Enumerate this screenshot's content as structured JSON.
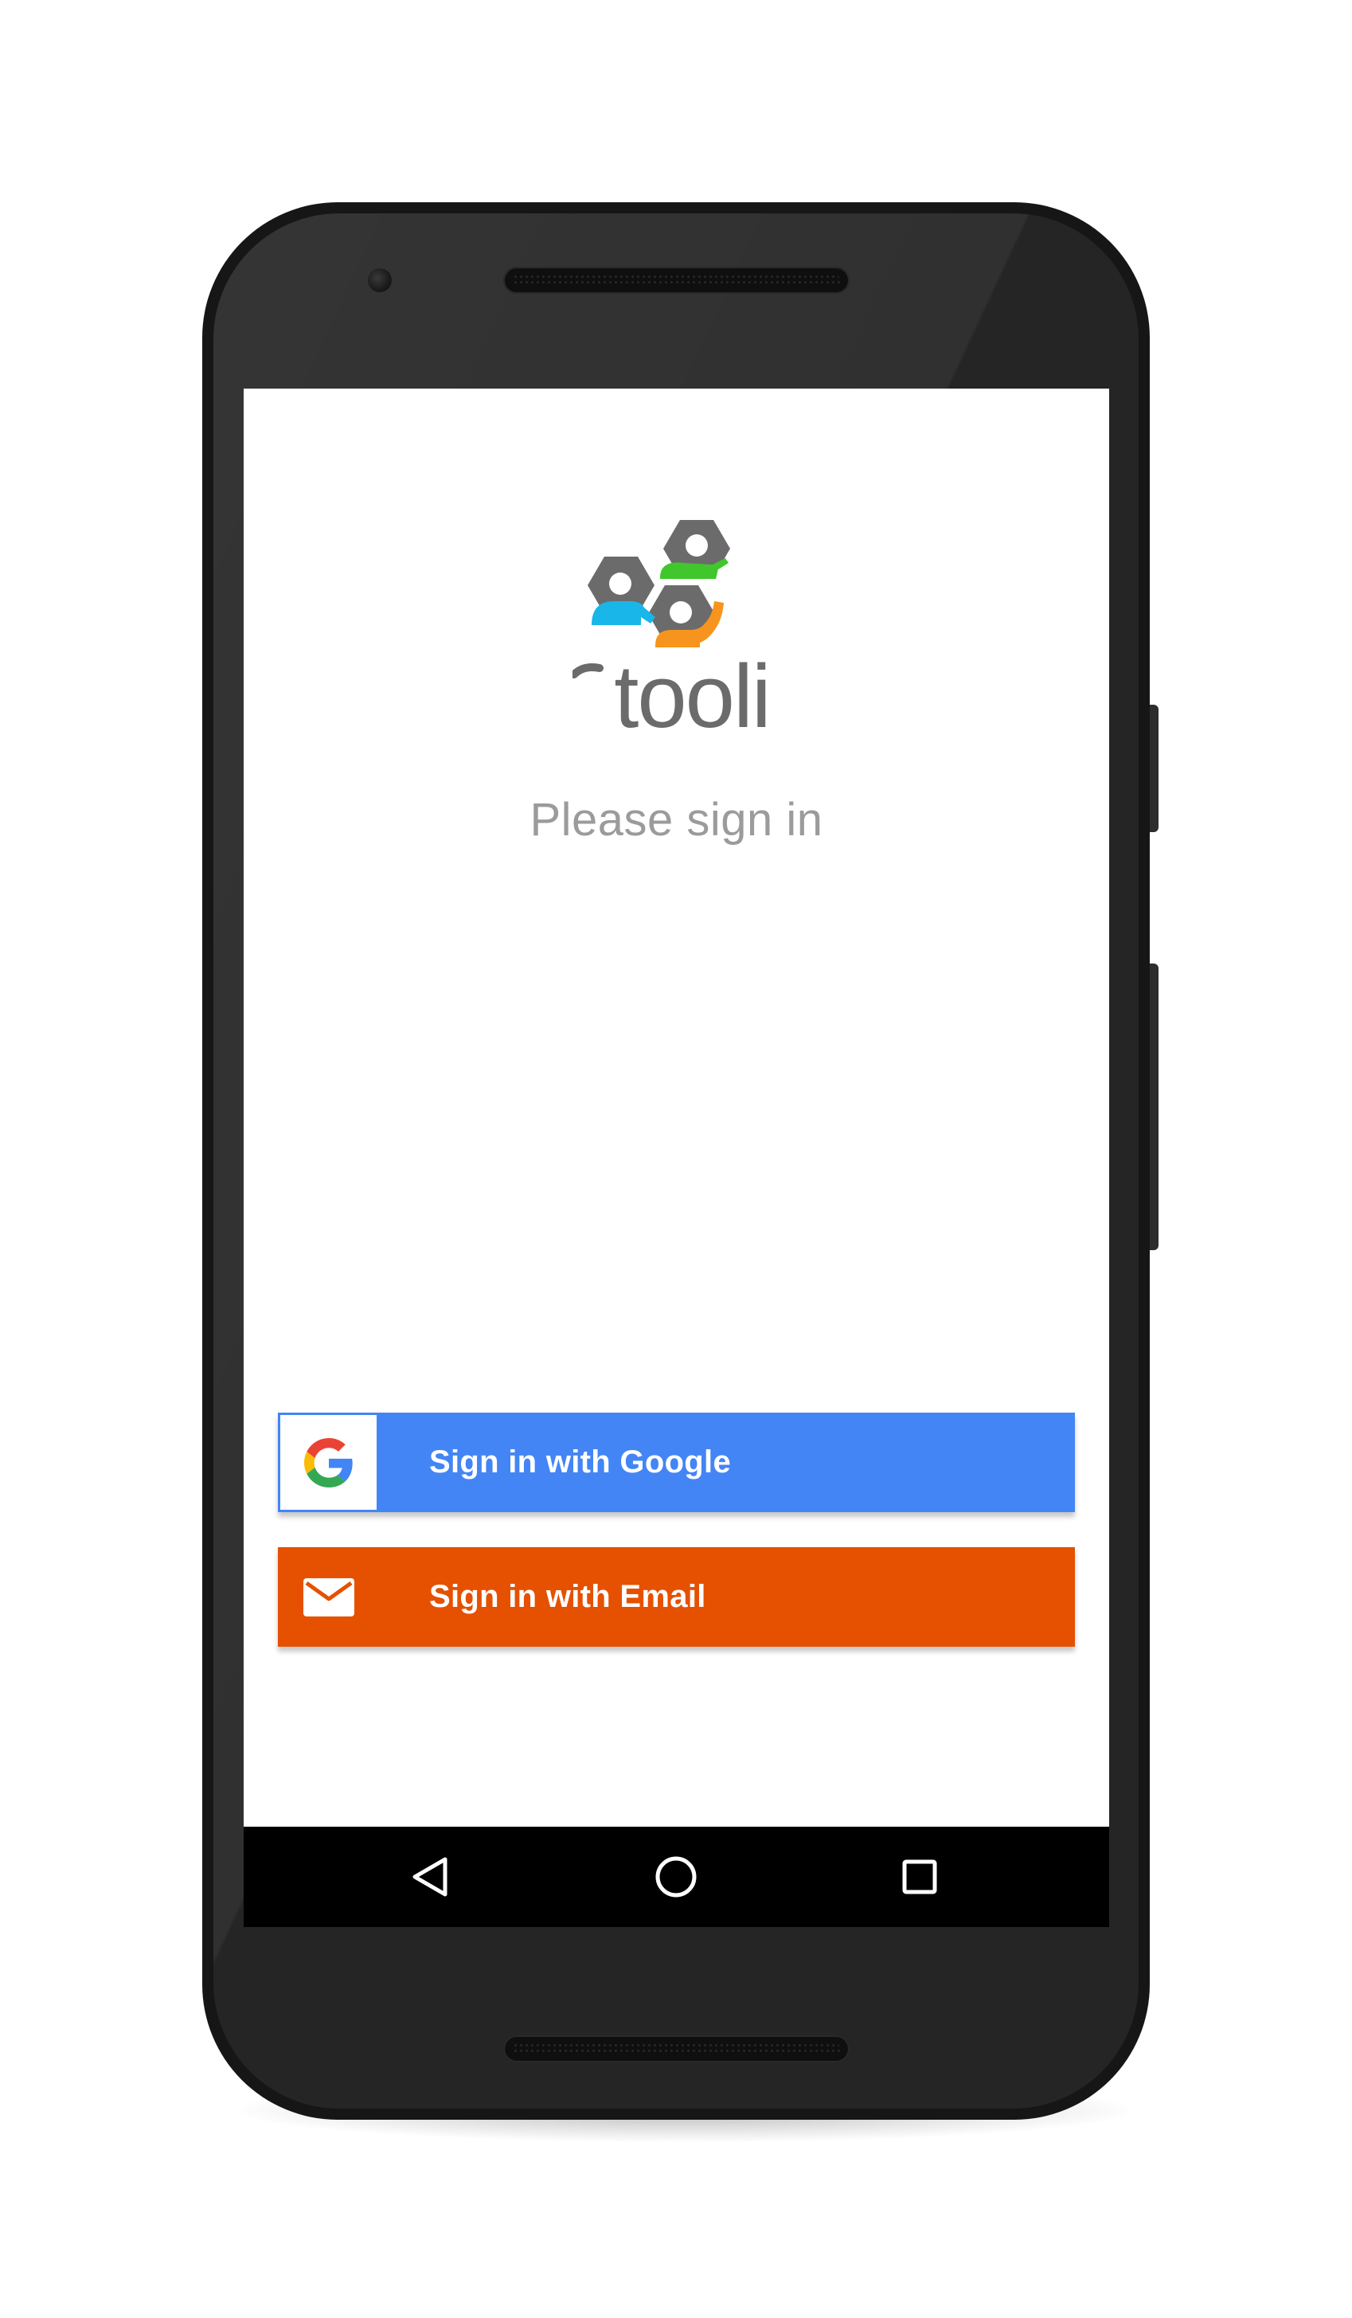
{
  "app": {
    "brand_name": "tooli",
    "logo_colors": {
      "hex": "#6b6b6b",
      "person_cyan": "#19b6e9",
      "person_green": "#3fc72b",
      "person_orange": "#f7941d"
    }
  },
  "sign_in": {
    "prompt": "Please sign in",
    "google_button": {
      "label": "Sign in with Google",
      "icon": "google-g-icon",
      "color": "#4385f5"
    },
    "email_button": {
      "label": "Sign in with Email",
      "icon": "envelope-icon",
      "color": "#e55100"
    }
  },
  "navigation_bar": {
    "buttons": [
      {
        "icon": "back-triangle-icon"
      },
      {
        "icon": "home-circle-icon"
      },
      {
        "icon": "recents-square-icon"
      }
    ]
  }
}
